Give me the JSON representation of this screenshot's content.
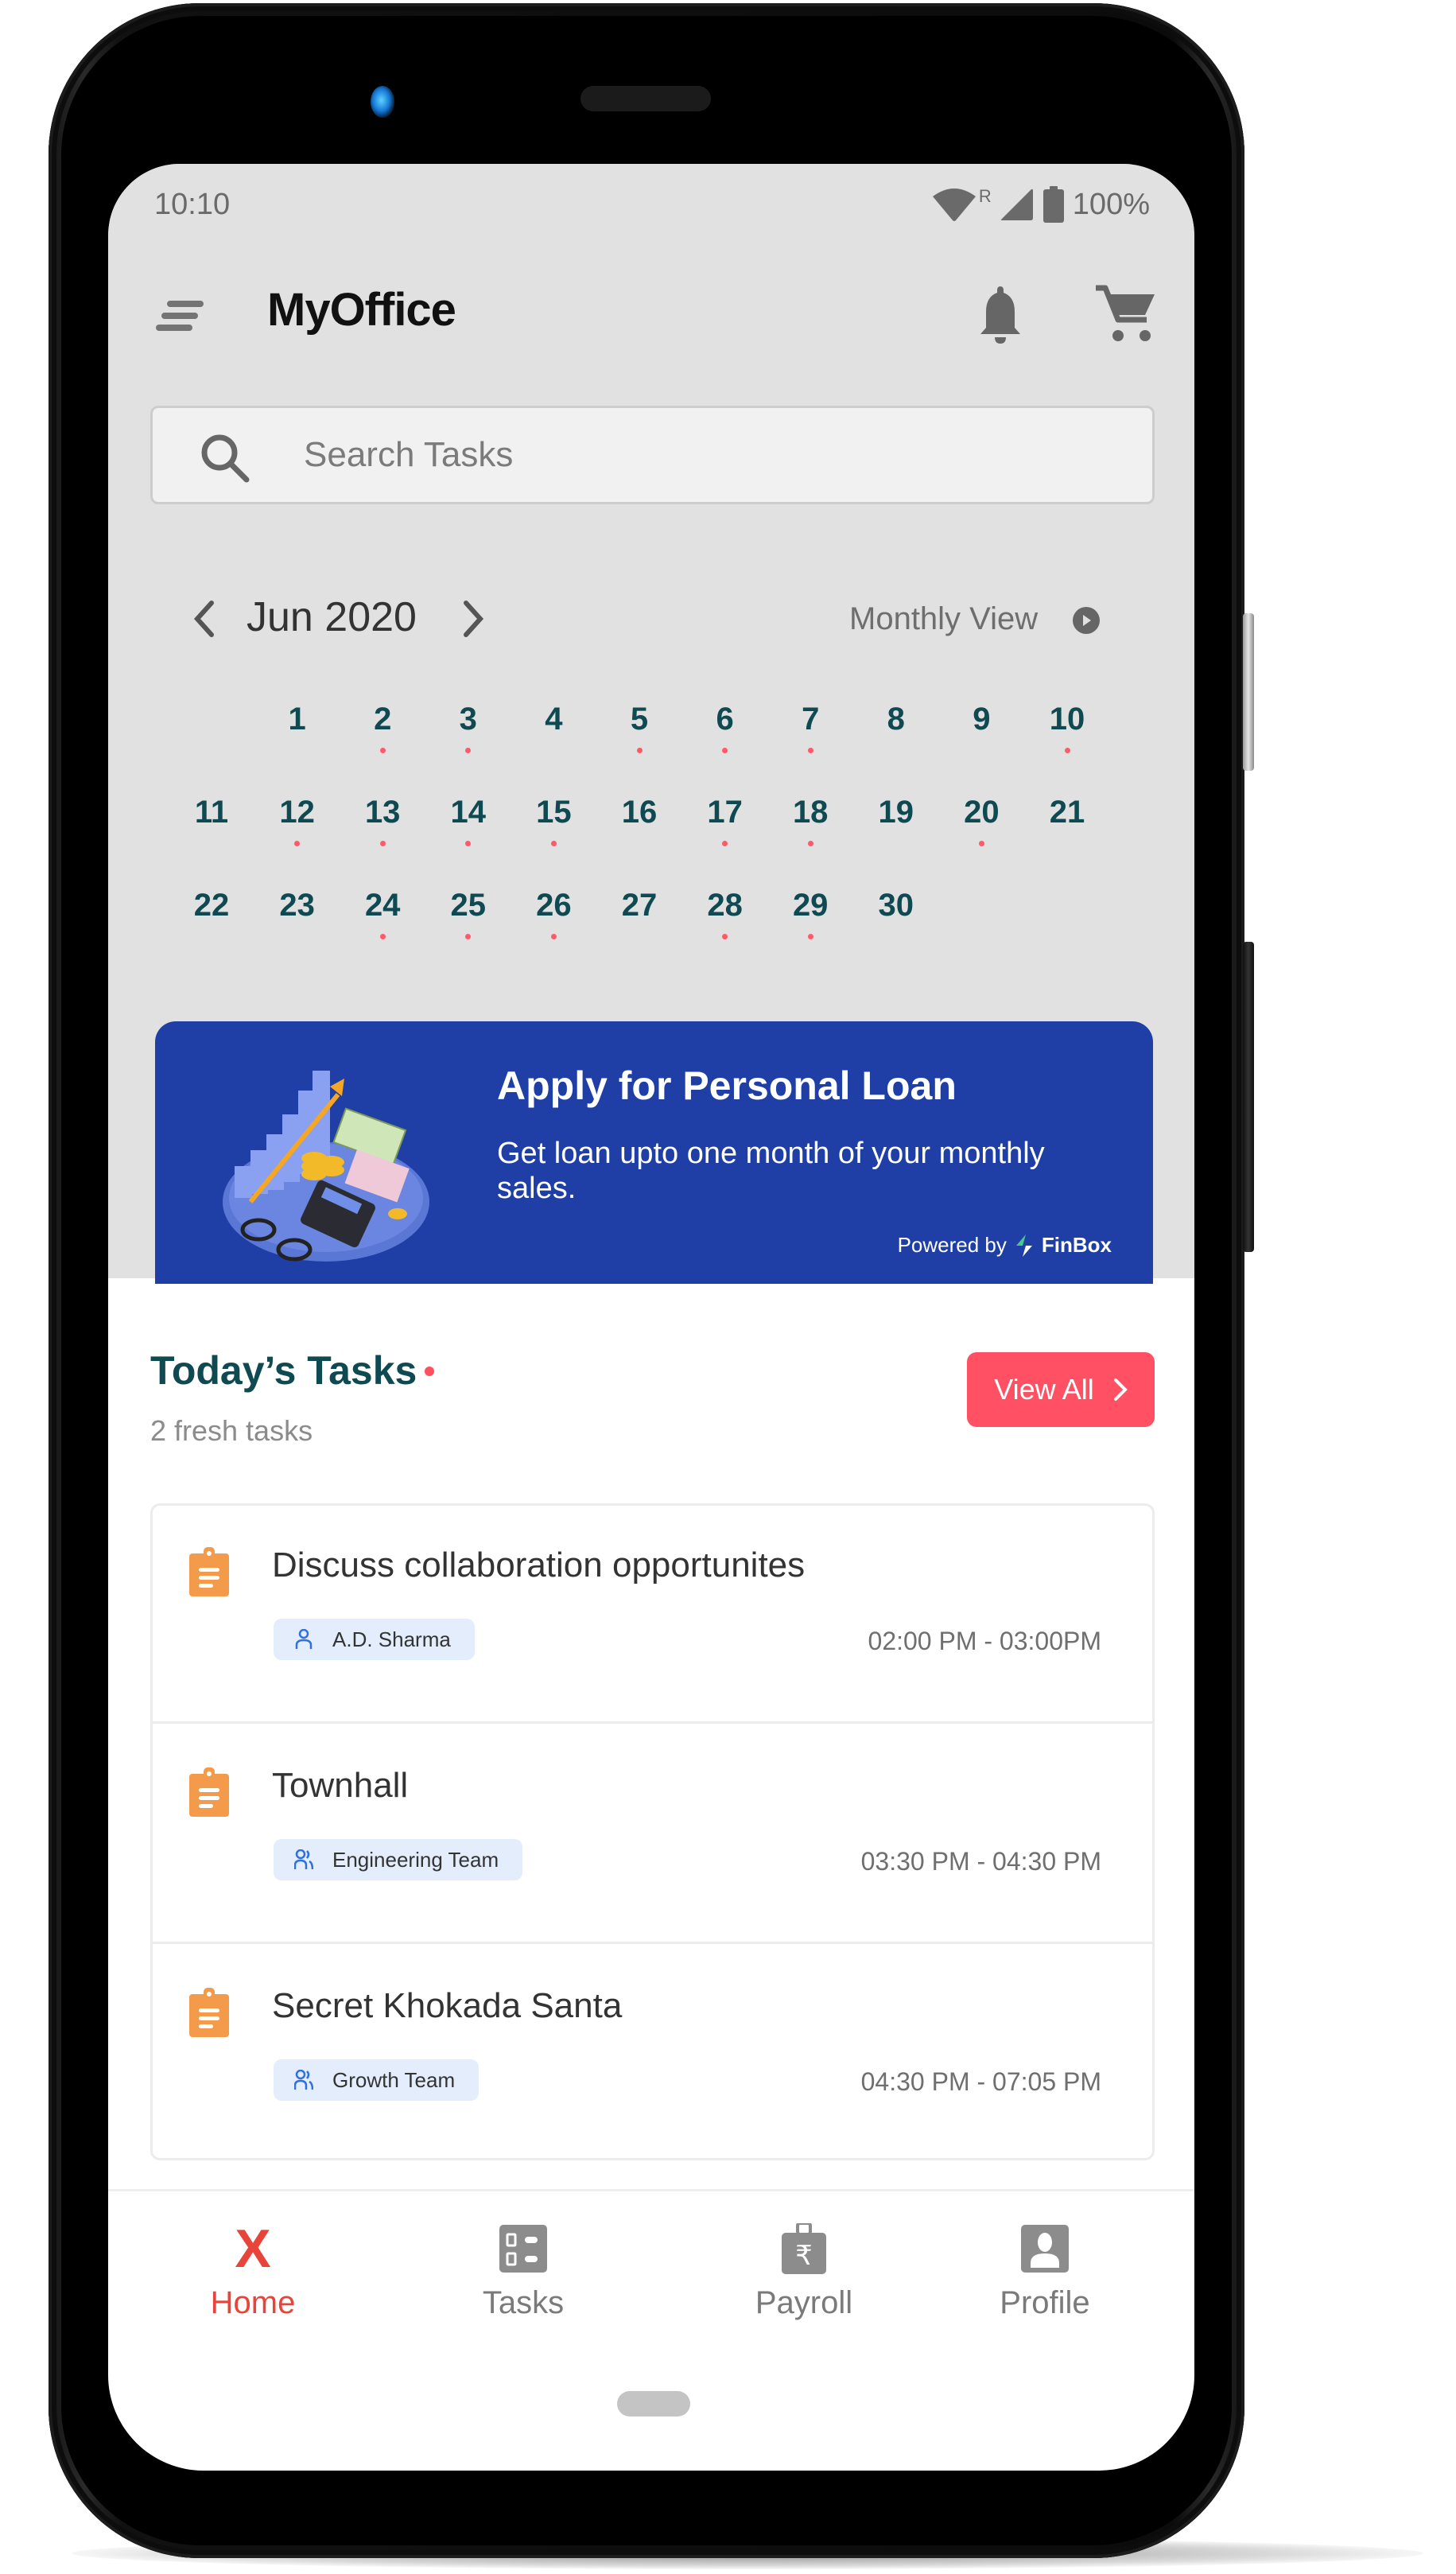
{
  "status_bar": {
    "time": "10:10",
    "roaming_label": "R",
    "battery": "100%"
  },
  "header": {
    "title": "MyOffice",
    "menu_icon": "hamburger-icon",
    "notification_icon": "bell-icon",
    "cart_icon": "cart-icon"
  },
  "search": {
    "placeholder": "Search Tasks",
    "value": ""
  },
  "calendar": {
    "month_label": "Jun 2020",
    "view_mode": "Monthly View",
    "leading_blank_days": 1,
    "days_in_month": 30,
    "days_with_events": [
      2,
      3,
      5,
      6,
      7,
      10,
      12,
      13,
      14,
      15,
      17,
      18,
      20,
      24,
      25,
      26,
      28,
      29
    ]
  },
  "banner": {
    "title": "Apply for Personal Loan",
    "text": "Get loan upto one month of your monthly sales.",
    "powered_by_label": "Powered by",
    "partner": "FinBox",
    "background_color": "#1f3fa6"
  },
  "tasks_section": {
    "title": "Today’s Tasks",
    "subtitle": "2 fresh tasks",
    "view_all_label": "View All",
    "accent_color": "#ff5163"
  },
  "tasks": [
    {
      "title": "Discuss collaboration opportunites",
      "assignee": "A.D. Sharma",
      "assignee_type": "person",
      "time": "02:00 PM - 03:00PM"
    },
    {
      "title": "Townhall",
      "assignee": "Engineering Team",
      "assignee_type": "group",
      "time": "03:30 PM - 04:30 PM"
    },
    {
      "title": "Secret Khokada Santa",
      "assignee": "Growth Team",
      "assignee_type": "group",
      "time": "04:30 PM - 07:05 PM"
    }
  ],
  "bottom_nav": {
    "active": "Home",
    "items": [
      {
        "label": "Home",
        "icon": "x-icon"
      },
      {
        "label": "Tasks",
        "icon": "tasks-icon"
      },
      {
        "label": "Payroll",
        "icon": "payroll-briefcase-icon"
      },
      {
        "label": "Profile",
        "icon": "profile-icon"
      }
    ]
  }
}
